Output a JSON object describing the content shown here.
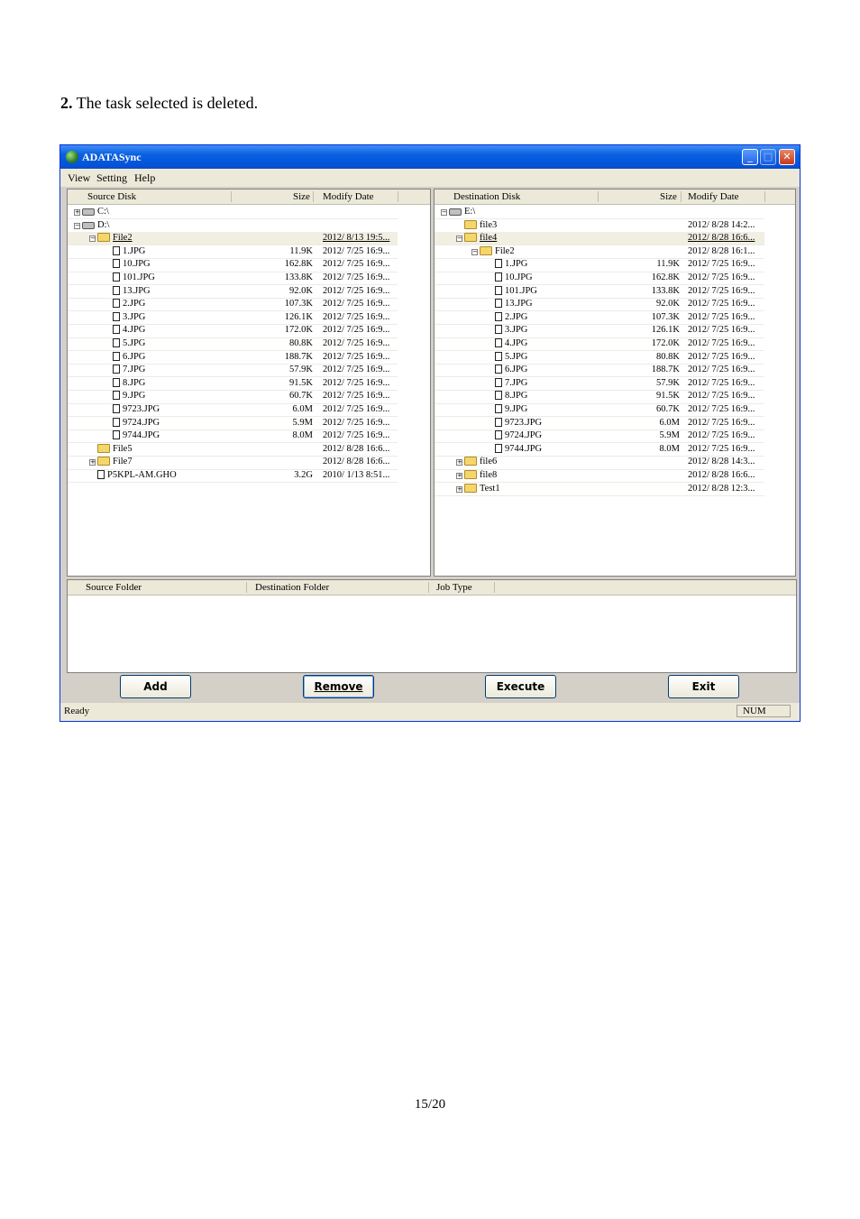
{
  "document": {
    "step_number": "2.",
    "step_text": "The task selected is deleted.",
    "page_number": "15/20"
  },
  "window": {
    "title": "ADATASync",
    "menu": [
      "View",
      "Setting",
      "Help"
    ]
  },
  "source_pane": {
    "headers": {
      "name": "Source Disk",
      "size": "Size",
      "date": "Modify Date"
    },
    "rows": [
      {
        "indent": 0,
        "icon": "drive-icon",
        "expander": "+",
        "name": "C:\\",
        "size": "",
        "date": "",
        "selected": false
      },
      {
        "indent": 0,
        "icon": "drive-icon",
        "expander": "-",
        "name": "D:\\",
        "size": "",
        "date": "",
        "selected": false
      },
      {
        "indent": 1,
        "icon": "folder-icon",
        "expander": "-",
        "name": "File2",
        "size": "",
        "date": "2012/ 8/13 19:5...",
        "selected": true
      },
      {
        "indent": 2,
        "icon": "file-icon",
        "expander": "",
        "name": "1.JPG",
        "size": "11.9K",
        "date": "2012/ 7/25 16:9...",
        "selected": false
      },
      {
        "indent": 2,
        "icon": "file-icon",
        "expander": "",
        "name": "10.JPG",
        "size": "162.8K",
        "date": "2012/ 7/25 16:9...",
        "selected": false
      },
      {
        "indent": 2,
        "icon": "file-icon",
        "expander": "",
        "name": "101.JPG",
        "size": "133.8K",
        "date": "2012/ 7/25 16:9...",
        "selected": false
      },
      {
        "indent": 2,
        "icon": "file-icon",
        "expander": "",
        "name": "13.JPG",
        "size": "92.0K",
        "date": "2012/ 7/25 16:9...",
        "selected": false
      },
      {
        "indent": 2,
        "icon": "file-icon",
        "expander": "",
        "name": "2.JPG",
        "size": "107.3K",
        "date": "2012/ 7/25 16:9...",
        "selected": false
      },
      {
        "indent": 2,
        "icon": "file-icon",
        "expander": "",
        "name": "3.JPG",
        "size": "126.1K",
        "date": "2012/ 7/25 16:9...",
        "selected": false
      },
      {
        "indent": 2,
        "icon": "file-icon",
        "expander": "",
        "name": "4.JPG",
        "size": "172.0K",
        "date": "2012/ 7/25 16:9...",
        "selected": false
      },
      {
        "indent": 2,
        "icon": "file-icon",
        "expander": "",
        "name": "5.JPG",
        "size": "80.8K",
        "date": "2012/ 7/25 16:9...",
        "selected": false
      },
      {
        "indent": 2,
        "icon": "file-icon",
        "expander": "",
        "name": "6.JPG",
        "size": "188.7K",
        "date": "2012/ 7/25 16:9...",
        "selected": false
      },
      {
        "indent": 2,
        "icon": "file-icon",
        "expander": "",
        "name": "7.JPG",
        "size": "57.9K",
        "date": "2012/ 7/25 16:9...",
        "selected": false
      },
      {
        "indent": 2,
        "icon": "file-icon",
        "expander": "",
        "name": "8.JPG",
        "size": "91.5K",
        "date": "2012/ 7/25 16:9...",
        "selected": false
      },
      {
        "indent": 2,
        "icon": "file-icon",
        "expander": "",
        "name": "9.JPG",
        "size": "60.7K",
        "date": "2012/ 7/25 16:9...",
        "selected": false
      },
      {
        "indent": 2,
        "icon": "file-icon",
        "expander": "",
        "name": "9723.JPG",
        "size": "6.0M",
        "date": "2012/ 7/25 16:9...",
        "selected": false
      },
      {
        "indent": 2,
        "icon": "file-icon",
        "expander": "",
        "name": "9724.JPG",
        "size": "5.9M",
        "date": "2012/ 7/25 16:9...",
        "selected": false
      },
      {
        "indent": 2,
        "icon": "file-icon",
        "expander": "",
        "name": "9744.JPG",
        "size": "8.0M",
        "date": "2012/ 7/25 16:9...",
        "selected": false
      },
      {
        "indent": 1,
        "icon": "folder-icon",
        "expander": "",
        "name": "File5",
        "size": "",
        "date": "2012/ 8/28 16:6...",
        "selected": false
      },
      {
        "indent": 1,
        "icon": "folder-icon",
        "expander": "+",
        "name": "File7",
        "size": "",
        "date": "2012/ 8/28 16:6...",
        "selected": false
      },
      {
        "indent": 1,
        "icon": "file-icon",
        "expander": "",
        "name": "P5KPL-AM.GHO",
        "size": "3.2G",
        "date": "2010/ 1/13 8:51...",
        "selected": false
      }
    ]
  },
  "destination_pane": {
    "headers": {
      "name": "Destination Disk",
      "size": "Size",
      "date": "Modify Date"
    },
    "rows": [
      {
        "indent": 0,
        "icon": "drive-icon",
        "expander": "-",
        "name": "E:\\",
        "size": "",
        "date": "",
        "selected": false
      },
      {
        "indent": 1,
        "icon": "folder-icon",
        "expander": "",
        "name": "file3",
        "size": "",
        "date": "2012/ 8/28 14:2...",
        "selected": false
      },
      {
        "indent": 1,
        "icon": "folder-icon",
        "expander": "-",
        "name": "file4",
        "size": "",
        "date": "2012/ 8/28 16:6...",
        "selected": true
      },
      {
        "indent": 2,
        "icon": "folder-icon",
        "expander": "-",
        "name": "File2",
        "size": "",
        "date": "2012/ 8/28 16:1...",
        "selected": false
      },
      {
        "indent": 3,
        "icon": "file-icon",
        "expander": "",
        "name": "1.JPG",
        "size": "11.9K",
        "date": "2012/ 7/25 16:9...",
        "selected": false
      },
      {
        "indent": 3,
        "icon": "file-icon",
        "expander": "",
        "name": "10.JPG",
        "size": "162.8K",
        "date": "2012/ 7/25 16:9...",
        "selected": false
      },
      {
        "indent": 3,
        "icon": "file-icon",
        "expander": "",
        "name": "101.JPG",
        "size": "133.8K",
        "date": "2012/ 7/25 16:9...",
        "selected": false
      },
      {
        "indent": 3,
        "icon": "file-icon",
        "expander": "",
        "name": "13.JPG",
        "size": "92.0K",
        "date": "2012/ 7/25 16:9...",
        "selected": false
      },
      {
        "indent": 3,
        "icon": "file-icon",
        "expander": "",
        "name": "2.JPG",
        "size": "107.3K",
        "date": "2012/ 7/25 16:9...",
        "selected": false
      },
      {
        "indent": 3,
        "icon": "file-icon",
        "expander": "",
        "name": "3.JPG",
        "size": "126.1K",
        "date": "2012/ 7/25 16:9...",
        "selected": false
      },
      {
        "indent": 3,
        "icon": "file-icon",
        "expander": "",
        "name": "4.JPG",
        "size": "172.0K",
        "date": "2012/ 7/25 16:9...",
        "selected": false
      },
      {
        "indent": 3,
        "icon": "file-icon",
        "expander": "",
        "name": "5.JPG",
        "size": "80.8K",
        "date": "2012/ 7/25 16:9...",
        "selected": false
      },
      {
        "indent": 3,
        "icon": "file-icon",
        "expander": "",
        "name": "6.JPG",
        "size": "188.7K",
        "date": "2012/ 7/25 16:9...",
        "selected": false
      },
      {
        "indent": 3,
        "icon": "file-icon",
        "expander": "",
        "name": "7.JPG",
        "size": "57.9K",
        "date": "2012/ 7/25 16:9...",
        "selected": false
      },
      {
        "indent": 3,
        "icon": "file-icon",
        "expander": "",
        "name": "8.JPG",
        "size": "91.5K",
        "date": "2012/ 7/25 16:9...",
        "selected": false
      },
      {
        "indent": 3,
        "icon": "file-icon",
        "expander": "",
        "name": "9.JPG",
        "size": "60.7K",
        "date": "2012/ 7/25 16:9...",
        "selected": false
      },
      {
        "indent": 3,
        "icon": "file-icon",
        "expander": "",
        "name": "9723.JPG",
        "size": "6.0M",
        "date": "2012/ 7/25 16:9...",
        "selected": false
      },
      {
        "indent": 3,
        "icon": "file-icon",
        "expander": "",
        "name": "9724.JPG",
        "size": "5.9M",
        "date": "2012/ 7/25 16:9...",
        "selected": false
      },
      {
        "indent": 3,
        "icon": "file-icon",
        "expander": "",
        "name": "9744.JPG",
        "size": "8.0M",
        "date": "2012/ 7/25 16:9...",
        "selected": false
      },
      {
        "indent": 1,
        "icon": "folder-icon",
        "expander": "+",
        "name": "file6",
        "size": "",
        "date": "2012/ 8/28 14:3...",
        "selected": false
      },
      {
        "indent": 1,
        "icon": "folder-icon",
        "expander": "+",
        "name": "file8",
        "size": "",
        "date": "2012/ 8/28 16:6...",
        "selected": false
      },
      {
        "indent": 1,
        "icon": "folder-icon",
        "expander": "+",
        "name": "Test1",
        "size": "",
        "date": "2012/ 8/28 12:3...",
        "selected": false
      }
    ]
  },
  "jobs": {
    "headers": {
      "source": "Source Folder",
      "destination": "Destination Folder",
      "type": "Job Type"
    }
  },
  "buttons": {
    "add": "Add",
    "remove": "Remove",
    "execute": "Execute",
    "exit": "Exit"
  },
  "statusbar": {
    "status": "Ready",
    "num": "NUM"
  }
}
